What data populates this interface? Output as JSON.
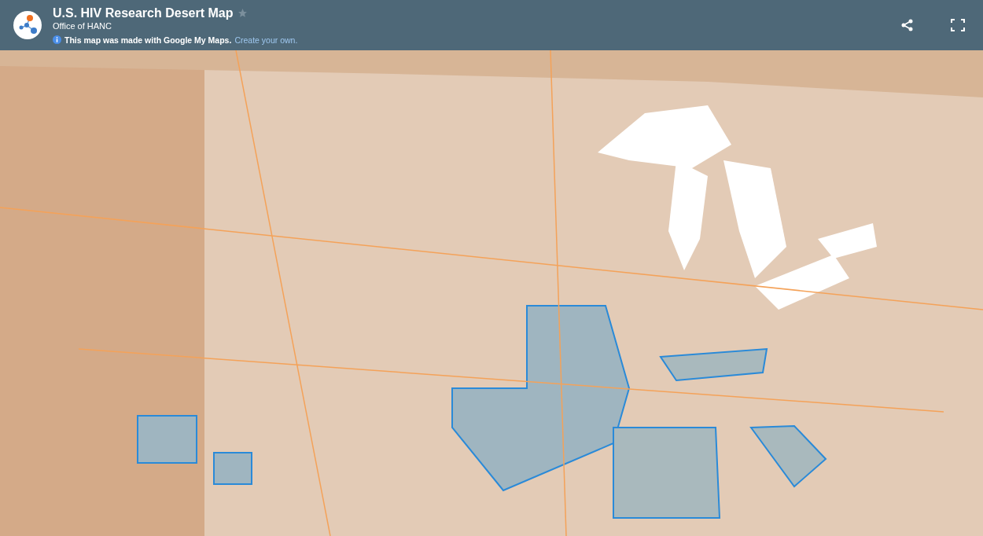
{
  "header": {
    "title": "U.S. HIV Research Desert Map",
    "starred": false,
    "subtitle": "Office of HANC",
    "notice": "This map was made with Google My Maps.",
    "notice_link": "Create your own."
  }
}
